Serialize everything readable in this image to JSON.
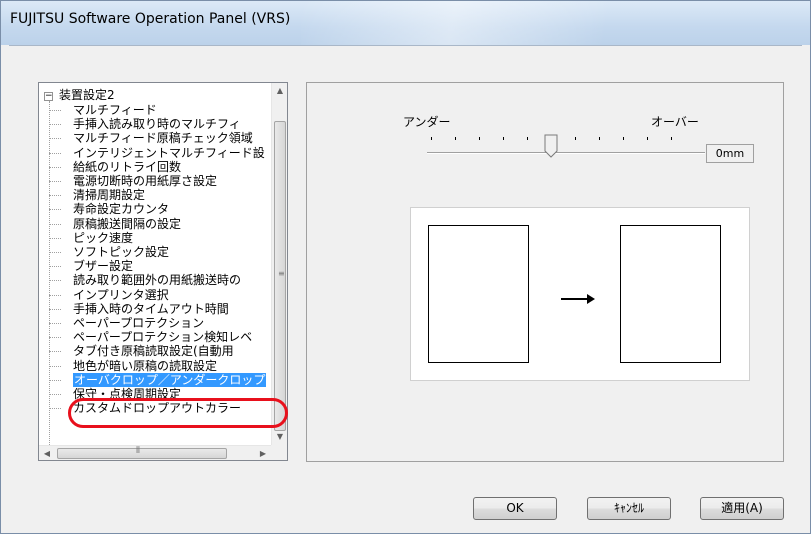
{
  "window": {
    "title": "FUJITSU Software Operation Panel (VRS)"
  },
  "tree": {
    "root_label": "装置設定2",
    "items": [
      "マルチフィード",
      "手挿入読み取り時のマルチフィ",
      "マルチフィード原稿チェック領域",
      "インテリジェントマルチフィード設",
      "給紙のリトライ回数",
      "電源切断時の用紙厚さ設定",
      "清掃周期設定",
      "寿命設定カウンタ",
      "原稿搬送間隔の設定",
      "ピック速度",
      "ソフトピック設定",
      "ブザー設定",
      "読み取り範囲外の用紙搬送時の",
      "インプリンタ選択",
      "手挿入時のタイムアウト時間",
      "ペーパープロテクション",
      "ペーパープロテクション検知レベ",
      "タブ付き原稿読取設定(自動用",
      "地色が暗い原稿の読取設定",
      "オーバクロップ／アンダークロップ",
      "保守・点検周期設定",
      "カスタムドロップアウトカラー"
    ],
    "selected_index": 19
  },
  "panel": {
    "label_under": "アンダー",
    "label_over": "オーバー",
    "value": "0mm",
    "slider_position_fraction": 0.5
  },
  "buttons": {
    "ok": "OK",
    "cancel": "ｷｬﾝｾﾙ",
    "apply": "適用(A)"
  },
  "colors": {
    "highlight": "#e8101c",
    "selection": "#3399ff"
  }
}
